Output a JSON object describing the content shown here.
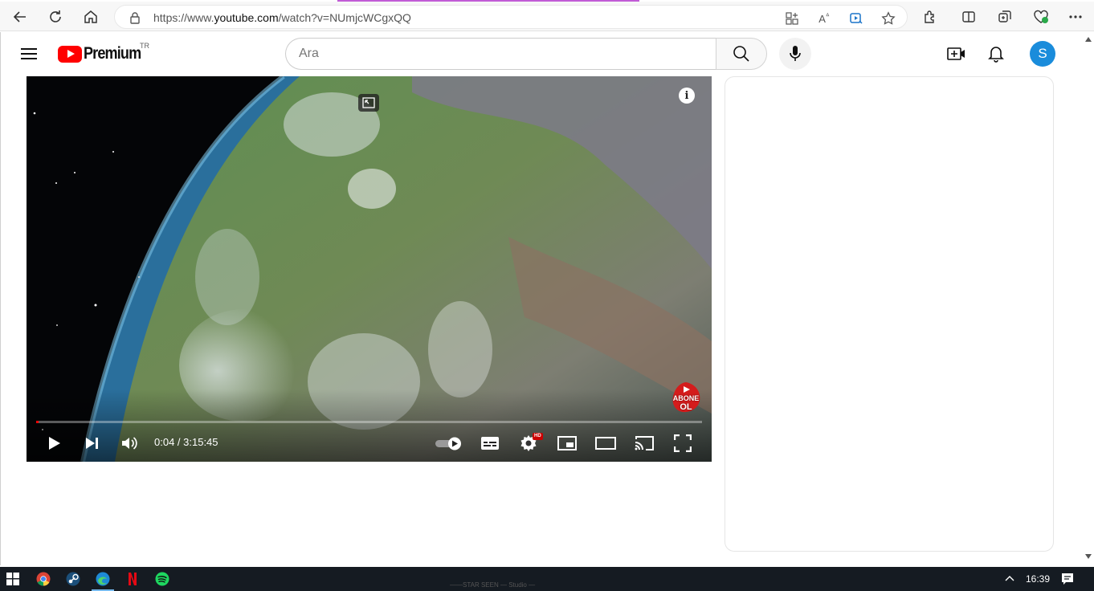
{
  "browser": {
    "url_prefix": "https://www.",
    "url_domain": "youtube.com",
    "url_path": "/watch?v=NUmjcWCgxQQ",
    "read_aloud_label": "A"
  },
  "youtube": {
    "brand": "Premium",
    "country_code": "TR",
    "search_placeholder": "Ara",
    "avatar_letter": "S"
  },
  "player": {
    "current_time": "0:04",
    "duration": "3:15:45",
    "time_display": "0:04 / 3:15:45",
    "progress_fraction": 0.0003,
    "hd_badge": "HD",
    "info_label": "i",
    "watermark_line1": "ABONE",
    "watermark_line2": "OL"
  },
  "taskbar": {
    "clock": "16:39",
    "background_text": "——STAR SEEN — Studio —"
  },
  "colors": {
    "youtube_red": "#ff0000",
    "avatar_bg": "#1a8cdb",
    "taskbar_bg": "#151b22",
    "accent_line": "#c15bd6"
  }
}
